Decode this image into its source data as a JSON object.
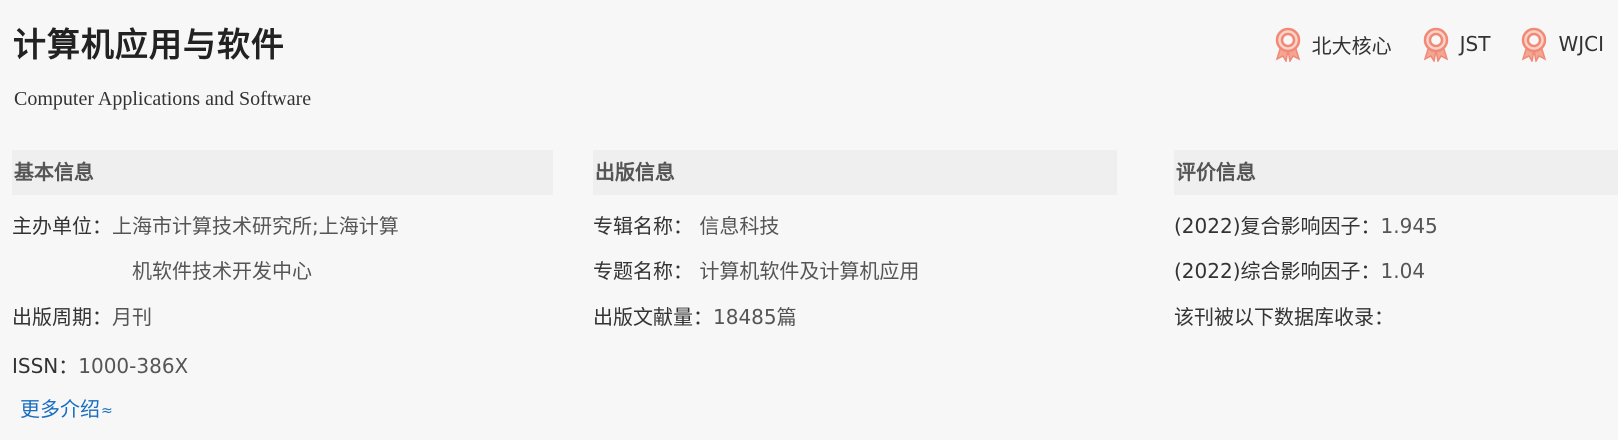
{
  "journal": {
    "title_cn": "计算机应用与软件",
    "title_en": "Computer Applications and Software"
  },
  "badges": [
    {
      "label": "北大核心",
      "icon": "award-ribbon-icon"
    },
    {
      "label": "JST",
      "icon": "award-ribbon-icon"
    },
    {
      "label": "WJCI",
      "icon": "award-ribbon-icon"
    }
  ],
  "colors": {
    "badge_icon": "#f08a76",
    "link": "#1a6ec0",
    "section_header_bg": "#efefef"
  },
  "basic_info": {
    "header": "基本信息",
    "sponsor_label": "主办单位：",
    "sponsor_line1": "上海市计算技术研究所;上海计算",
    "sponsor_line2": "机软件技术开发中心",
    "period_label": "出版周期：",
    "period_value": "月刊",
    "issn_label": "ISSN：",
    "issn_value": "1000-386X",
    "more_label": "更多介绍",
    "more_icon": "double-chevron-down-icon"
  },
  "publish_info": {
    "header": "出版信息",
    "album_label": "专辑名称：",
    "album_value": "信息科技",
    "topic_label": "专题名称：",
    "topic_value": "计算机软件及计算机应用",
    "count_label": "出版文献量：",
    "count_value": "18485篇"
  },
  "eval_info": {
    "header": "评价信息",
    "composite_if_label": "(2022)复合影响因子：",
    "composite_if_value": "1.945",
    "comprehensive_if_label": "(2022)综合影响因子：",
    "comprehensive_if_value": "1.04",
    "indexed_label": "该刊被以下数据库收录："
  }
}
